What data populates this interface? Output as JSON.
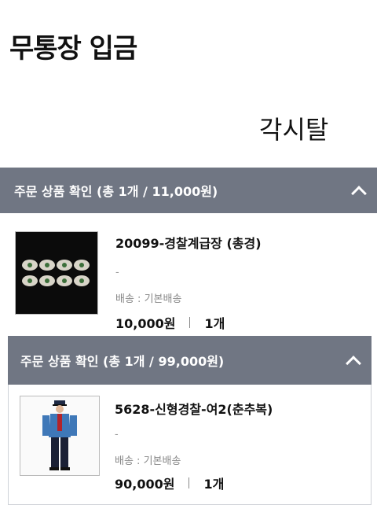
{
  "payment": {
    "title": "무통장 입금",
    "depositor": "각시탈"
  },
  "orders": [
    {
      "header": "주문 상품 확인 (총 1개 / 11,000원)",
      "product": {
        "name": "20099-경찰계급장 (총경)",
        "option": "-",
        "shipping": "배송 : 기본배송",
        "price": "10,000원",
        "quantity": "1개",
        "image": "police-rank-insignia-image"
      }
    },
    {
      "header": "주문 상품 확인 (총 1개 / 99,000원)",
      "product": {
        "name": "5628-신형경찰-여2(춘추복)",
        "option": "-",
        "shipping": "배송 : 기본배송",
        "price": "90,000원",
        "quantity": "1개",
        "image": "police-uniform-image"
      }
    }
  ],
  "colors": {
    "header_bg": "#707683",
    "header_text": "#ffffff"
  }
}
